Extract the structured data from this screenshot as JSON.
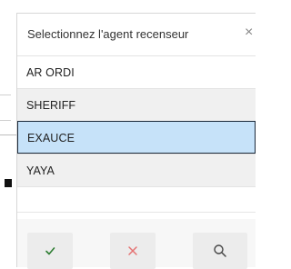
{
  "dialog": {
    "title": "Selectionnez l'agent recenseur",
    "close_icon": "×",
    "items": [
      {
        "label": "AR ORDI"
      },
      {
        "label": "SHERIFF"
      },
      {
        "label": "EXAUCE",
        "selected": true
      },
      {
        "label": "YAYA"
      },
      {
        "label": ""
      }
    ],
    "buttons": [
      {
        "icon": "check-icon",
        "color": "#2e7d32"
      },
      {
        "icon": "close-icon",
        "color": "#e57373"
      },
      {
        "icon": "search-icon",
        "color": "#444444"
      }
    ]
  }
}
